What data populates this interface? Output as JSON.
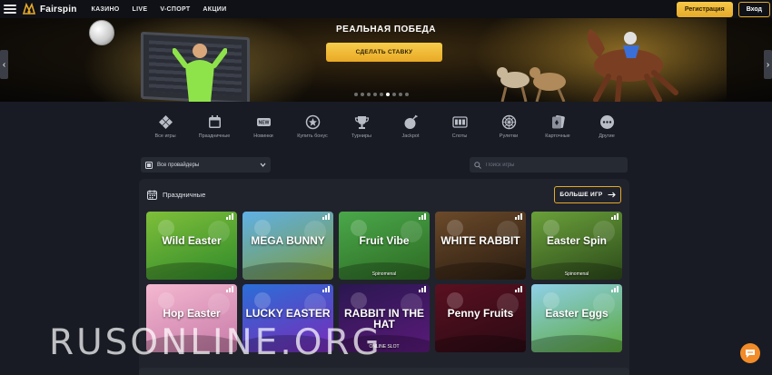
{
  "header": {
    "brand": "Fairspin",
    "nav": [
      "КАЗИНО",
      "LIVE",
      "V-СПОРТ",
      "АКЦИИ"
    ],
    "register_label": "Регистрация",
    "login_label": "Вход"
  },
  "hero": {
    "title": "РЕАЛЬНАЯ ПОБЕДА",
    "cta_label": "СДЕЛАТЬ СТАВКУ",
    "slide_count": 9,
    "active_slide": 5
  },
  "categories": [
    {
      "label": "Все игры",
      "icon": "all-games-icon"
    },
    {
      "label": "Праздничные",
      "icon": "calendar-icon"
    },
    {
      "label": "Новинки",
      "icon": "new-badge-icon",
      "badge": "NEW"
    },
    {
      "label": "Купить бонус",
      "icon": "bonus-icon"
    },
    {
      "label": "Турниры",
      "icon": "trophy-icon"
    },
    {
      "label": "Jackpot",
      "icon": "bomb-icon"
    },
    {
      "label": "Слоты",
      "icon": "slots-icon"
    },
    {
      "label": "Рулетки",
      "icon": "roulette-icon"
    },
    {
      "label": "Карточные",
      "icon": "cards-icon"
    },
    {
      "label": "Другие",
      "icon": "more-icon"
    }
  ],
  "filters": {
    "provider_label": "Все провайдеры",
    "search_placeholder": "Поиск игры"
  },
  "section": {
    "title": "Праздничные",
    "more_label": "БОЛЬШЕ ИГР"
  },
  "games": [
    {
      "name": "Wild Easter",
      "provider": "",
      "colors": [
        "#7fbf3a",
        "#2f8a2a"
      ]
    },
    {
      "name": "MEGA BUNNY",
      "provider": "",
      "colors": [
        "#5fb0e6",
        "#7c9b3a"
      ]
    },
    {
      "name": "Fruit Vibe",
      "provider": "Spinomenal",
      "colors": [
        "#4aa84a",
        "#2d6a23"
      ]
    },
    {
      "name": "WHITE RABBIT",
      "provider": "",
      "colors": [
        "#6b4a2a",
        "#2a1c10"
      ]
    },
    {
      "name": "Easter Spin",
      "provider": "Spinomenal",
      "colors": [
        "#6aa03a",
        "#2c4a1a"
      ]
    },
    {
      "name": "Hop Easter",
      "provider": "",
      "colors": [
        "#f4b8d0",
        "#c77aa8"
      ]
    },
    {
      "name": "LUCKY EASTER",
      "provider": "",
      "colors": [
        "#2a6fd8",
        "#7a2ab8"
      ]
    },
    {
      "name": "RABBIT IN THE HAT",
      "provider": "ONLINE SLOT",
      "colors": [
        "#2a1750",
        "#5a1a7a"
      ]
    },
    {
      "name": "Penny Fruits",
      "provider": "",
      "colors": [
        "#5a1020",
        "#2a0a14"
      ]
    },
    {
      "name": "Easter Eggs",
      "provider": "",
      "colors": [
        "#8fd0e8",
        "#5aa83a"
      ]
    }
  ],
  "watermark": "RUSONLINE.ORG",
  "accent": "#e9a925"
}
